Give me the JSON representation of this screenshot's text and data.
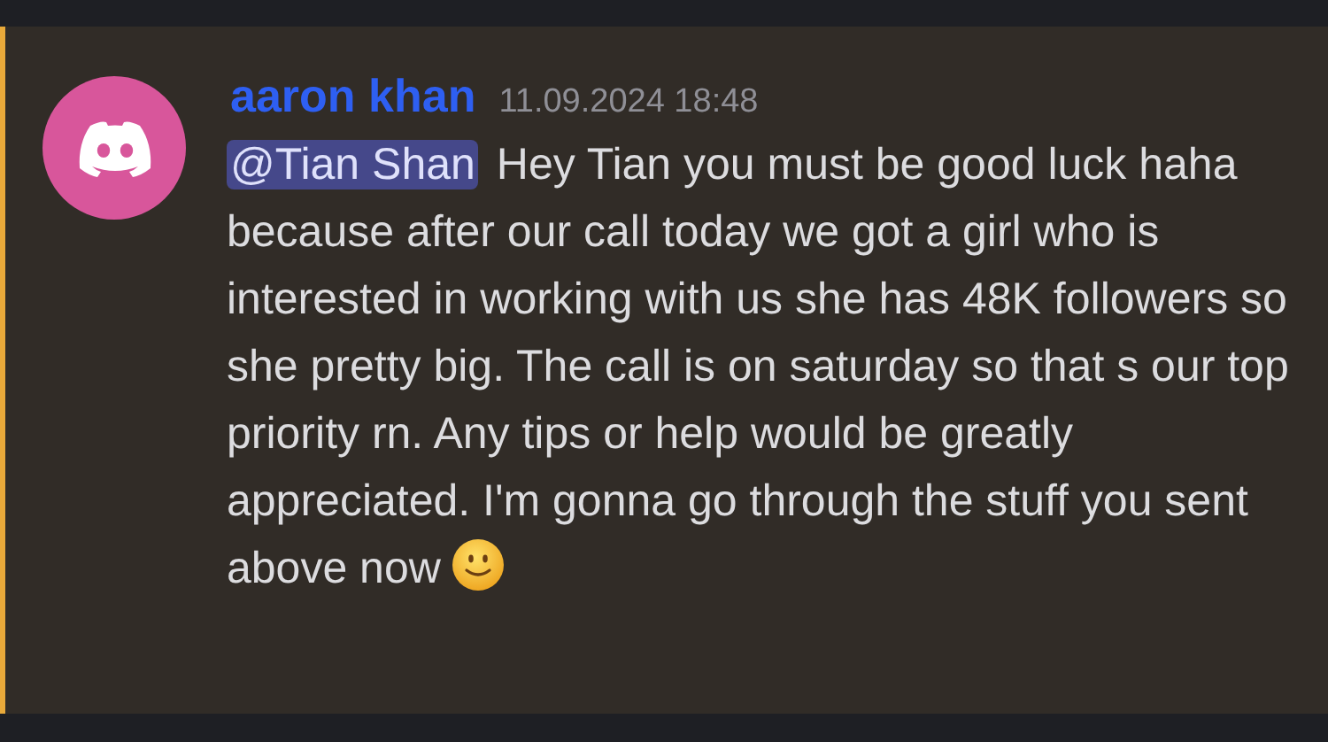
{
  "message": {
    "author": "aaron khan",
    "timestamp": "11.09.2024 18:48",
    "mention": "@Tian Shan",
    "text": "Hey Tian you must be good luck haha because after our call today we got a girl who is interested in working with us she has 48K followers so she pretty big. The call is on saturday so that s our top priority rn. Any tips or help would be greatly appreciated. I'm gonna go through the stuff you sent above now",
    "highlighted": true
  }
}
